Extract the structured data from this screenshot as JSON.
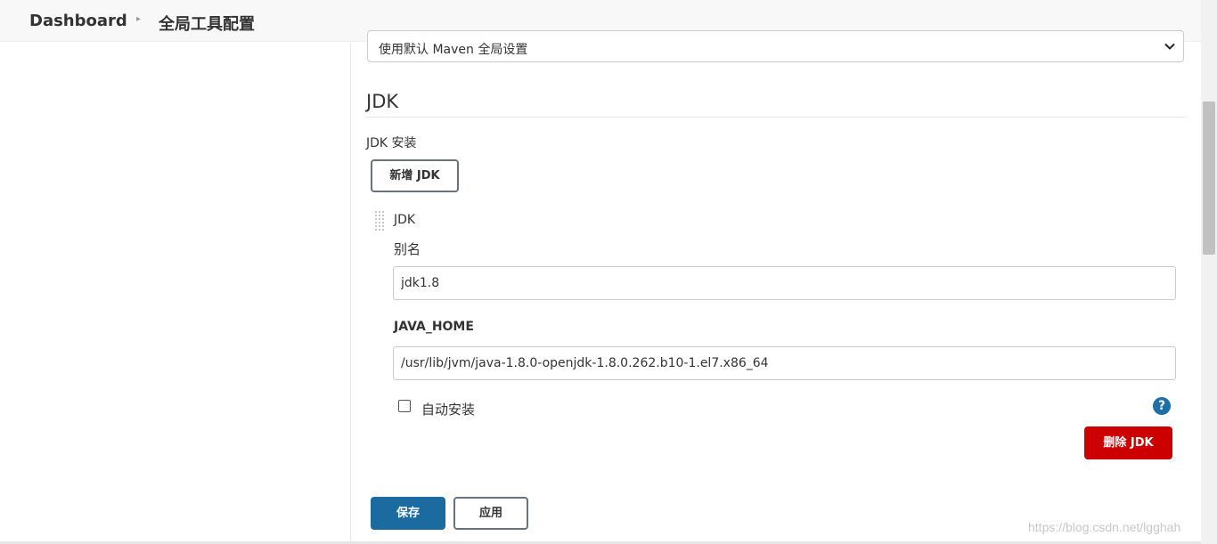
{
  "breadcrumb": {
    "dashboard": "Dashboard",
    "current": "全局工具配置"
  },
  "maven_settings": {
    "selected": "使用默认 Maven 全局设置"
  },
  "jdk_section": {
    "title": "JDK",
    "install_label": "JDK 安装",
    "add_button": "新增 JDK",
    "item": {
      "title": "JDK",
      "alias_label": "别名",
      "alias_value": "jdk1.8",
      "java_home_label": "JAVA_HOME",
      "java_home_value": "/usr/lib/jvm/java-1.8.0-openjdk-1.8.0.262.b10-1.el7.x86_64",
      "auto_install_label": "自动安装",
      "auto_install_checked": false,
      "help": "?",
      "delete_button": "删除 JDK"
    }
  },
  "footer": {
    "save_button": "保存",
    "apply_button": "应用"
  },
  "watermark": "https://blog.csdn.net/lgghah",
  "colors": {
    "primary": "#1b6aa0",
    "danger": "#cc0000",
    "help": "#1e6ea8"
  }
}
